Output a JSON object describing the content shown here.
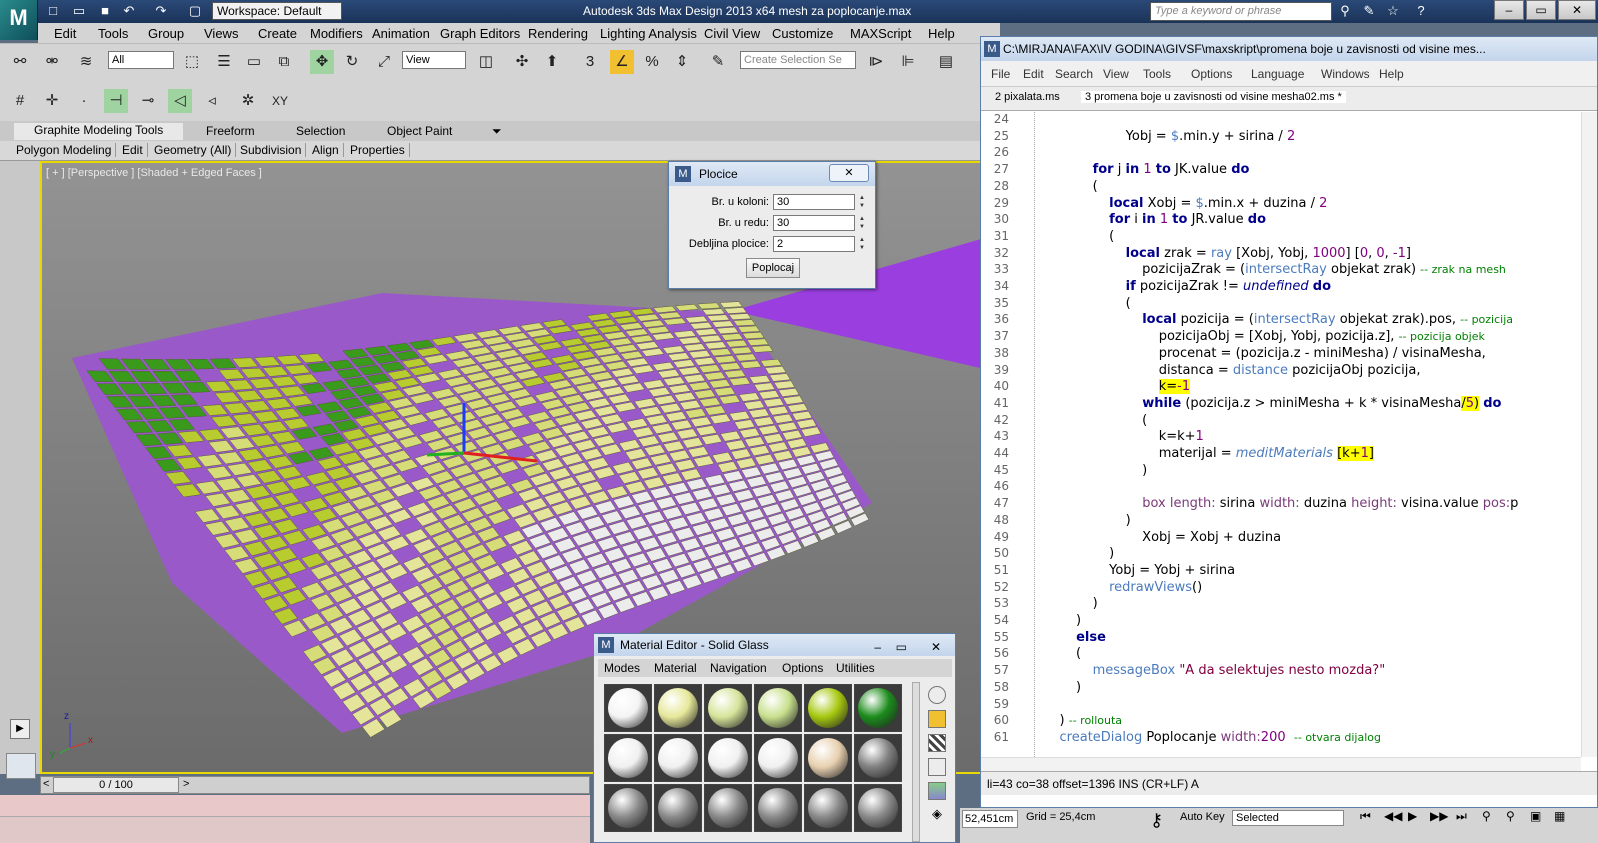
{
  "app": {
    "title": "Autodesk 3ds Max Design 2013 x64      mesh za poplocanje.max",
    "workspace": "Workspace: Default",
    "search_placeholder": "Type a keyword or phrase",
    "logo_text": "3DS"
  },
  "menubar": [
    "Edit",
    "Tools",
    "Group",
    "Views",
    "Create",
    "Modifiers",
    "Animation",
    "Graph Editors",
    "Rendering",
    "Lighting Analysis",
    "Civil View",
    "Customize",
    "MAXScript",
    "Help"
  ],
  "toolbar": {
    "selection_filter": "All",
    "ref_coord": "View",
    "named_selection_placeholder": "Create Selection Se",
    "snap_label": "3",
    "xy_label": "XY"
  },
  "ribbon": {
    "tabs": [
      "Graphite Modeling Tools",
      "Freeform",
      "Selection",
      "Object Paint"
    ],
    "subtabs": [
      "Polygon Modeling",
      "Edit",
      "Geometry (All)",
      "Subdivision",
      "Align",
      "Properties"
    ]
  },
  "viewport": {
    "label": "[ + ] [Perspective ] [Shaded + Edged Faces ]",
    "axis_z": "z",
    "axis_x": "x",
    "axis_y": "y"
  },
  "timeline": {
    "frame": "0 / 100",
    "prev": "<",
    "next": ">"
  },
  "plocice": {
    "title": "Plocice",
    "fields": [
      {
        "label": "Br. u koloni:",
        "value": "30"
      },
      {
        "label": "Br. u redu:",
        "value": "30"
      },
      {
        "label": "Debljina plocice:",
        "value": "2"
      }
    ],
    "button": "Poplocaj"
  },
  "material_editor": {
    "title": "Material Editor - Solid Glass",
    "menu": [
      "Modes",
      "Material",
      "Navigation",
      "Options",
      "Utilities"
    ],
    "spheres_row1": [
      "#f4f4f4",
      "#e6e89a",
      "#d6e49a",
      "#c8e08e",
      "#a6c810",
      "#1c8c1c"
    ],
    "spheres_row2": [
      "#f0f0f0",
      "#f0f0f0",
      "#f0f0f0",
      "#f0f0f0",
      "#e8d0b0",
      "#808080"
    ],
    "spheres_row3": [
      "#8a8a8a",
      "#8a8a8a",
      "#8a8a8a",
      "#8a8a8a",
      "#8a8a8a",
      "#8a8a8a"
    ]
  },
  "editor": {
    "title": "C:\\MIRJANA\\FAX\\IV GODINA\\GIVSF\\maxskript\\promena boje u zavisnosti od visine mes...",
    "menu": [
      "File",
      "Edit",
      "Search",
      "View",
      "Tools",
      "Options",
      "Language",
      "Windows",
      "Help"
    ],
    "tabs": [
      "2 pixalata.ms",
      "3 promena boje u zavisnosti od visine mesha02.ms *"
    ],
    "status": "li=43 co=38 offset=1396 INS (CR+LF) A",
    "lines": [
      {
        "n": "24",
        "html": ""
      },
      {
        "n": "25",
        "html": "                    Yobj = <span class='fn'>$</span>.min.y + sirina / <span class='num'>2</span>"
      },
      {
        "n": "26",
        "html": ""
      },
      {
        "n": "27",
        "html": "            <span class='kw'>for</span> j <span class='kw'>in</span> <span class='num'>1</span> <span class='kw'>to</span> JK.value <span class='kw'>do</span>"
      },
      {
        "n": "28",
        "html": "            ("
      },
      {
        "n": "29",
        "html": "                <span class='kw'>local</span> Xobj = <span class='fn'>$</span>.min.x + duzina / <span class='num'>2</span>"
      },
      {
        "n": "30",
        "html": "                <span class='kw'>for</span> i <span class='kw'>in</span> <span class='num'>1</span> <span class='kw'>to</span> JR.value <span class='kw'>do</span>"
      },
      {
        "n": "31",
        "html": "                ("
      },
      {
        "n": "32",
        "html": "                    <span class='kw'>local</span> zrak = <span class='fn'>ray</span> [Xobj, Yobj, <span class='num'>1000</span>] [<span class='num'>0</span>, <span class='num'>0</span>, <span class='num'>-1</span>]"
      },
      {
        "n": "33",
        "html": "                        pozicijaZrak = (<span class='fn'>intersectRay</span> objekat zrak) <span class='cm'>-- zrak na mesh</span>"
      },
      {
        "n": "34",
        "html": "                    <span class='kw'>if</span> pozicijaZrak != <span class='it'>undefined</span> <span class='kw'>do</span>"
      },
      {
        "n": "35",
        "html": "                    ("
      },
      {
        "n": "36",
        "html": "                        <span class='kw'>local</span> pozicija = (<span class='fn'>intersectRay</span> objekat zrak).pos, <span class='cm'>-- pozicija</span>"
      },
      {
        "n": "37",
        "html": "                            pozicijaObj = [Xobj, Yobj, pozicija.z], <span class='cm'>-- pozicija objek</span>"
      },
      {
        "n": "38",
        "html": "                            procenat = (pozicija.z - miniMesha) / visinaMesha,"
      },
      {
        "n": "39",
        "html": "                            distanca = <span class='fn'>distance</span> pozicijaObj pozicija,"
      },
      {
        "n": "40",
        "html": "                            <span class='hl'>k=<span class='num'>-1</span></span>"
      },
      {
        "n": "41",
        "html": "                        <span class='kw'>while</span> (pozicija.z &gt; miniMesha + k * visinaMesha<span class='hl'>/<span class='num'>5</span>)</span> <span class='kw'>do</span>"
      },
      {
        "n": "42",
        "html": "                        ("
      },
      {
        "n": "43",
        "html": "                            k=k+<span class='num'>1</span>"
      },
      {
        "n": "44",
        "html": "                            materijal = <span class='it' style='color:#4b7bbd;font-weight:normal'>meditMaterials</span> <span class='hl'>[k+<span class='num'>1</span>]</span>"
      },
      {
        "n": "45",
        "html": "                        )"
      },
      {
        "n": "46",
        "html": ""
      },
      {
        "n": "47",
        "html": "                        <span class='prm'>box</span> <span class='prm'>length:</span> sirina <span class='prm'>width:</span> duzina <span class='prm'>height:</span> visina.value <span class='prm'>pos:</span>p"
      },
      {
        "n": "48",
        "html": "                    )"
      },
      {
        "n": "49",
        "html": "                        Xobj = Xobj + duzina"
      },
      {
        "n": "50",
        "html": "                )"
      },
      {
        "n": "51",
        "html": "                Yobj = Yobj + sirina"
      },
      {
        "n": "52",
        "html": "                <span class='fn'>redrawViews</span>()"
      },
      {
        "n": "53",
        "html": "            )"
      },
      {
        "n": "54",
        "html": "        )"
      },
      {
        "n": "55",
        "html": "        <span class='kw'>else</span>"
      },
      {
        "n": "56",
        "html": "        ("
      },
      {
        "n": "57",
        "html": "            <span class='fn'>messageBox</span> <span class='str'>\"A da selektujes nesto mozda?\"</span>"
      },
      {
        "n": "58",
        "html": "        )"
      },
      {
        "n": "59",
        "html": ""
      },
      {
        "n": "60",
        "html": "    ) <span class='cm'>-- rollouta</span>"
      },
      {
        "n": "61",
        "html": "    <span class='fn'>createDialog</span> Poplocanje <span class='prm'>width:</span><span class='num'>200</span>  <span class='cm'>-- otvara dijalog</span>"
      }
    ]
  },
  "bottom": {
    "coord": "52,451cm",
    "grid": "Grid = 25,4cm",
    "autokey": "Auto Key",
    "selected": "Selected"
  }
}
